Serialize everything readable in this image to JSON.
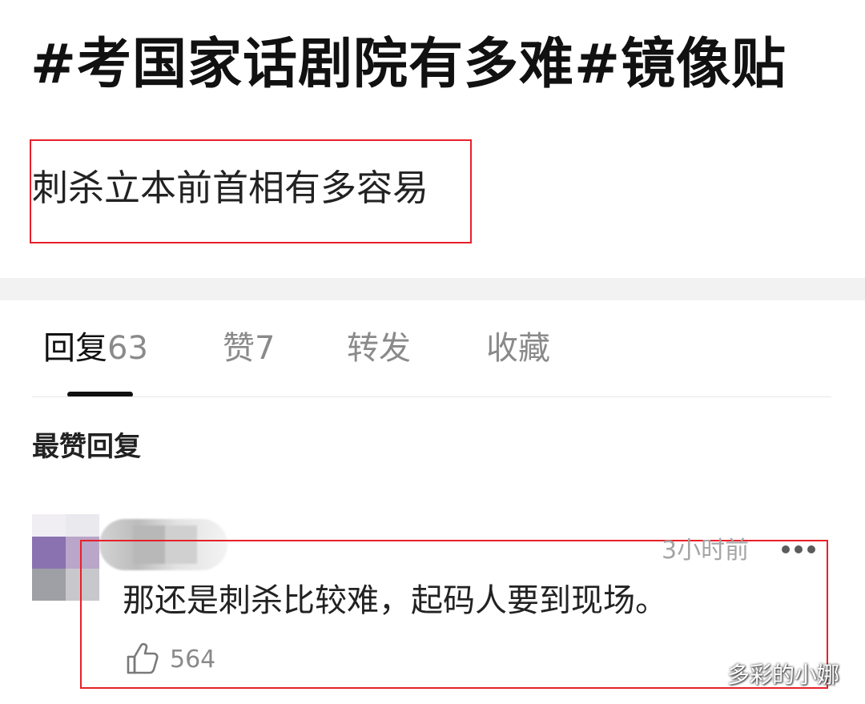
{
  "post": {
    "title": "#考国家话剧院有多难#镜像贴",
    "body": "刺杀立本前首相有多容易"
  },
  "tabs": [
    {
      "label": "回复",
      "count": "63",
      "active": true
    },
    {
      "label": "赞",
      "count": "7",
      "active": false
    },
    {
      "label": "转发",
      "count": "",
      "active": false
    },
    {
      "label": "收藏",
      "count": "",
      "active": false
    }
  ],
  "section": {
    "heading": "最赞回复"
  },
  "reply": {
    "time": "3小时前",
    "text": "那还是刺杀比较难，起码人要到现场。",
    "like_count": "564",
    "more_icon": "more-dots-icon",
    "like_icon": "thumbs-up-icon"
  },
  "watermark": "多彩的小娜",
  "colors": {
    "highlight_border": "#e8202a",
    "active_tab_text": "#111111",
    "inactive_tab_text": "#8a8a8a",
    "separator": "#f2f2f2"
  }
}
